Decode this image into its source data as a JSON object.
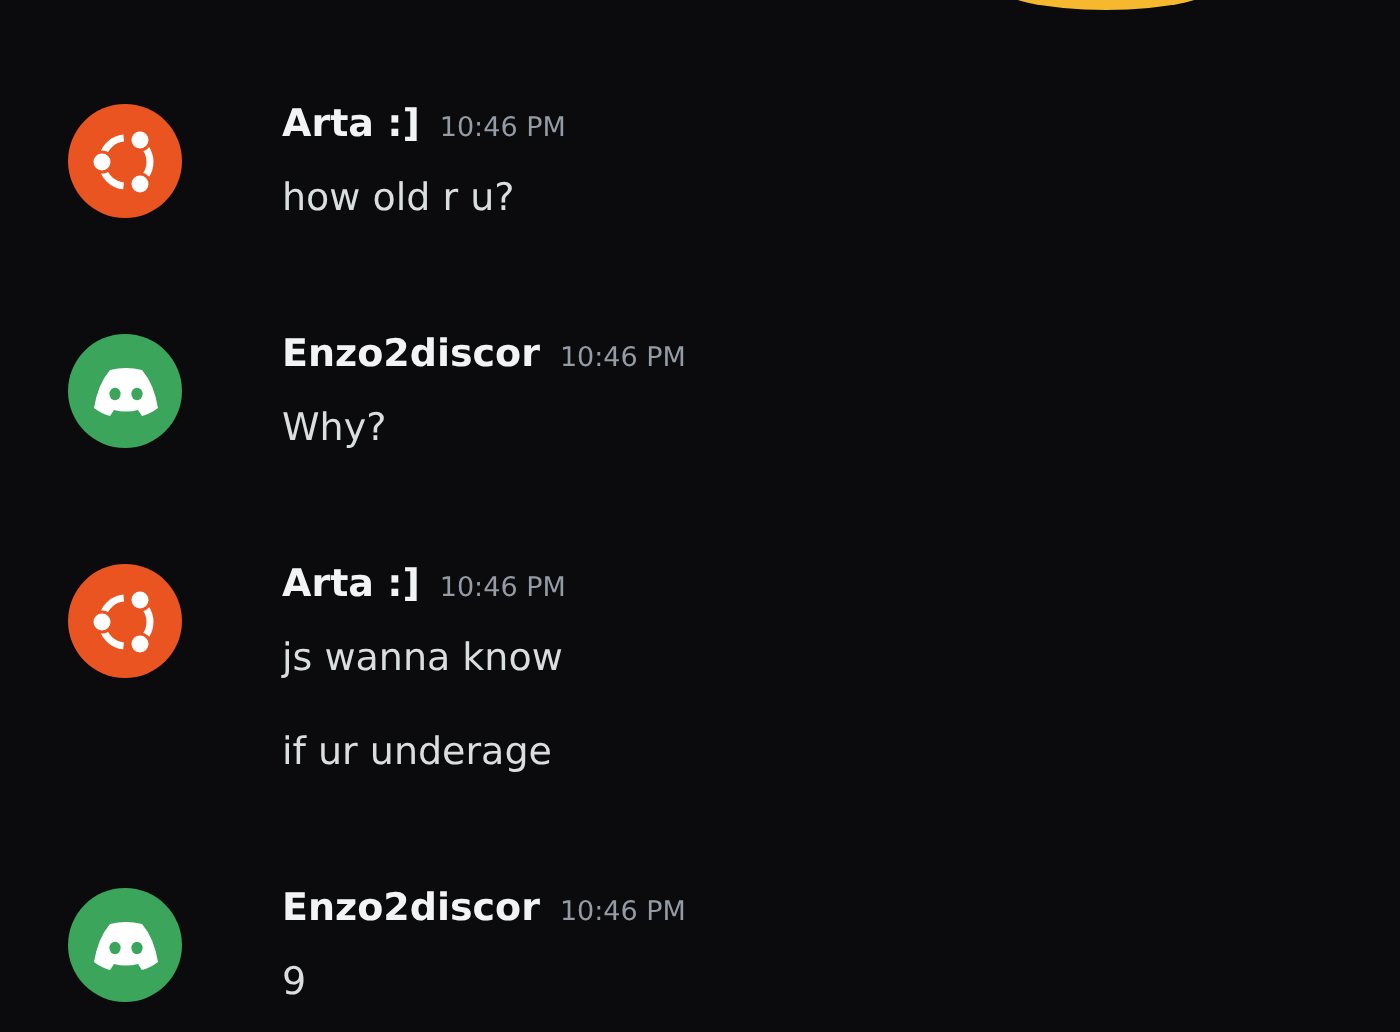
{
  "top_emoji": {
    "kind": "emoji"
  },
  "messages": [
    {
      "author": "Arta :]",
      "time": "10:46 PM",
      "avatar": {
        "kind": "ring"
      },
      "lines": [
        "how old r u?"
      ]
    },
    {
      "author": "Enzo2discor",
      "time": "10:46 PM",
      "avatar": {
        "kind": "controller"
      },
      "lines": [
        "Why?"
      ]
    },
    {
      "author": "Arta :]",
      "time": "10:46 PM",
      "avatar": {
        "kind": "ring"
      },
      "lines": [
        "js wanna know",
        "if ur underage"
      ]
    },
    {
      "author": "Enzo2discor",
      "time": "10:46 PM",
      "avatar": {
        "kind": "controller"
      },
      "lines": [
        "9"
      ]
    }
  ]
}
